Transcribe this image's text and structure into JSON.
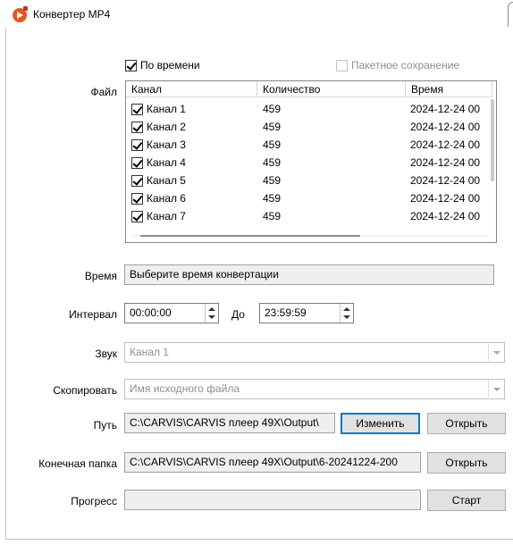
{
  "window": {
    "title": "Конвертер MP4"
  },
  "options": {
    "by_time": {
      "label": "По времени",
      "checked": true
    },
    "batch_save": {
      "label": "Пакетное сохранение",
      "checked": false,
      "disabled": true
    }
  },
  "file": {
    "label": "Файл",
    "columns": [
      "Канал",
      "Количество",
      "Время"
    ],
    "rows": [
      {
        "channel": "Канал 1",
        "count": "459",
        "time": "2024-12-24 00"
      },
      {
        "channel": "Канал 2",
        "count": "459",
        "time": "2024-12-24 00"
      },
      {
        "channel": "Канал 3",
        "count": "459",
        "time": "2024-12-24 00"
      },
      {
        "channel": "Канал 4",
        "count": "459",
        "time": "2024-12-24 00"
      },
      {
        "channel": "Канал 5",
        "count": "459",
        "time": "2024-12-24 00"
      },
      {
        "channel": "Канал 6",
        "count": "459",
        "time": "2024-12-24 00"
      },
      {
        "channel": "Канал 7",
        "count": "459",
        "time": "2024-12-24 00"
      }
    ]
  },
  "time": {
    "label": "Время",
    "value": "Выберите время конвертации"
  },
  "interval": {
    "label": "Интервал",
    "from": "00:00:00",
    "to_label": "До",
    "to": "23:59:59"
  },
  "sound": {
    "label": "Звук",
    "value": "Канал 1"
  },
  "copy": {
    "label": "Скопировать",
    "value": "Имя исходного файла"
  },
  "path": {
    "label": "Путь",
    "value": "C:\\CARVIS\\CARVIS плеер 49X\\Output\\",
    "change_button": "Изменить",
    "open_button": "Открыть"
  },
  "dest": {
    "label": "Конечная папка",
    "value": "C:\\CARVIS\\CARVIS плеер 49X\\Output\\6-20241224-200",
    "open_button": "Открыть"
  },
  "progress": {
    "label": "Прогресс",
    "value": 0,
    "start_button": "Старт"
  }
}
